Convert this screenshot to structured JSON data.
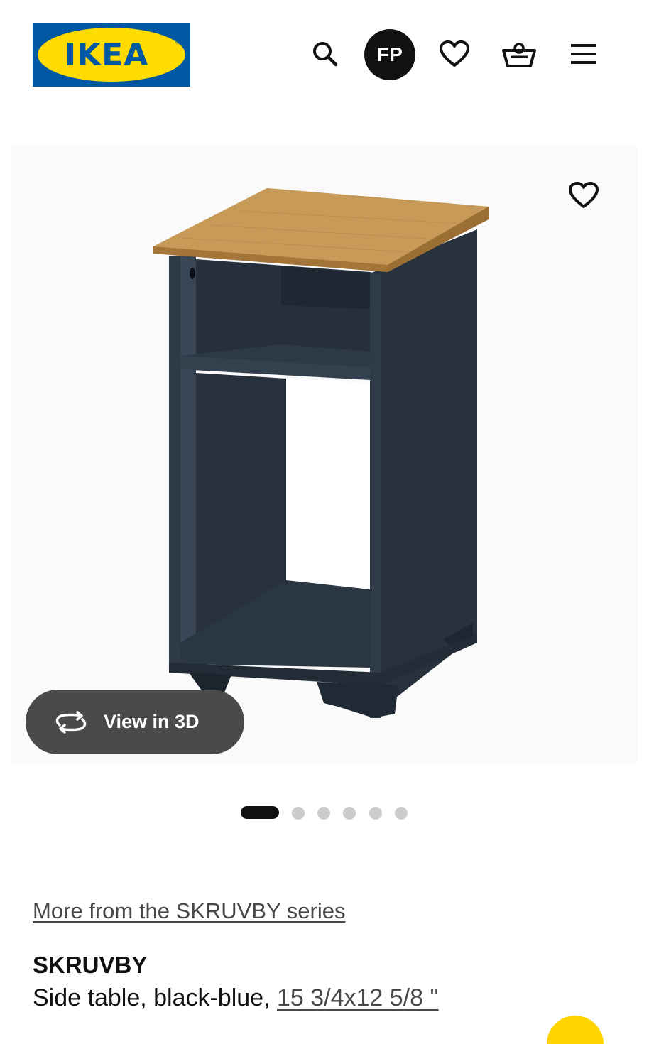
{
  "brand": {
    "logo_text": "IKEA",
    "blue": "#0058a3",
    "yellow": "#ffdb00"
  },
  "header": {
    "icons": [
      "search-icon",
      "heart-icon",
      "basket-icon",
      "menu-icon"
    ],
    "avatar_initials": "FP"
  },
  "gallery": {
    "view3d_label": "View in 3D",
    "slide_count": 6,
    "active_slide": 1
  },
  "product": {
    "series_link": "More from the SKRUVBY series",
    "name": "SKRUVBY",
    "description": "Side table, black-blue, ",
    "dimensions": "15 3/4x12 5/8 \""
  }
}
